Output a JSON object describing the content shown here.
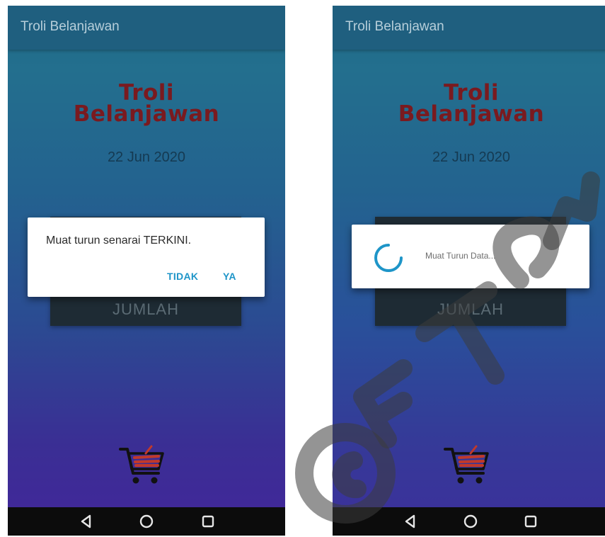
{
  "left_screen": {
    "appbar_title": "Troli Belanjawan",
    "hero_title_line1": "Troli",
    "hero_title_line2": "Belanjawan",
    "date": "22 Jun 2020",
    "jumlah_label": "JUMLAH",
    "dialog": {
      "message": "Muat turun senarai TERKINI.",
      "no_label": "TIDAK",
      "yes_label": "YA"
    }
  },
  "right_screen": {
    "appbar_title": "Troli Belanjawan",
    "hero_title_line1": "Troli",
    "hero_title_line2": "Belanjawan",
    "date": "22 Jun 2020",
    "jumlah_label": "JUMLAH",
    "progress": {
      "message": "Muat Turun Data..."
    }
  },
  "nav_icons": [
    "back-triangle-icon",
    "home-circle-icon",
    "recents-square-icon"
  ],
  "watermark_text": "@FTSM",
  "colors": {
    "appbar": "#1f5f7f",
    "title_red": "#7a1a1f",
    "accent_blue": "#1e95c8",
    "button_dark": "#1e2b34",
    "navbar": "#0c0c0c"
  }
}
